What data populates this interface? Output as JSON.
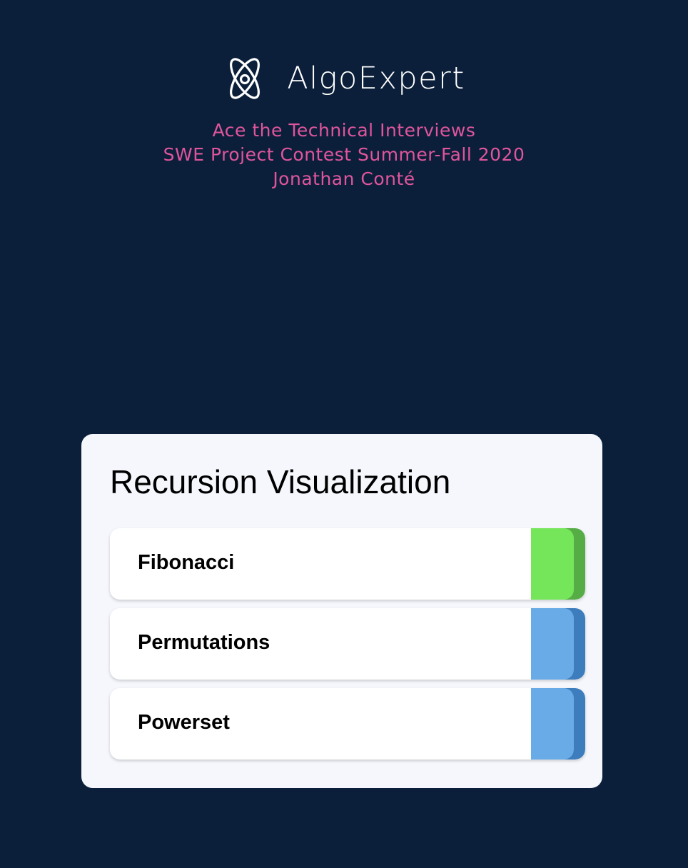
{
  "header": {
    "brand_name": "AlgoExpert",
    "logo_icon": "atom-icon",
    "tagline_lines": [
      "Ace the Technical Interviews",
      "SWE Project Contest Summer-Fall 2020",
      "Jonathan Conté"
    ]
  },
  "colors": {
    "background": "#0b1f3a",
    "accent_pink": "#e0559c",
    "card_background": "#f5f7fc",
    "green": "#75e65a",
    "green_dark": "#56ad45",
    "blue": "#68abe6",
    "blue_dark": "#3d7dbd"
  },
  "card": {
    "title": "Recursion Visualization",
    "items": [
      {
        "label": "Fibonacci",
        "color": "#75e65a",
        "shade": "#56ad45"
      },
      {
        "label": "Permutations",
        "color": "#68abe6",
        "shade": "#3d7dbd"
      },
      {
        "label": "Powerset",
        "color": "#68abe6",
        "shade": "#3d7dbd"
      }
    ]
  }
}
